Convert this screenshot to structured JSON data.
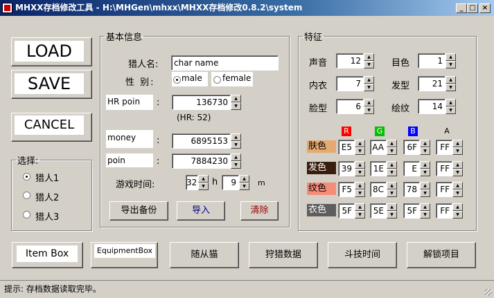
{
  "window": {
    "title": "MHXX存档修改工具 - H:\\MHGen\\mhxx\\MHXX存档修改0.8.2\\system",
    "min": "_",
    "max": "□",
    "close": "×"
  },
  "actions": {
    "load": "LOAD",
    "save": "SAVE",
    "cancel": "CANCEL"
  },
  "select_group": {
    "title": "选择:",
    "options": [
      "猎人1",
      "猎人2",
      "猎人3"
    ],
    "selected": 0
  },
  "basic": {
    "title": "基本信息",
    "name_label": "猎人名:",
    "name": "char name",
    "gender_label": "性 别:",
    "male": "male",
    "female": "female",
    "hr_label": "HR poin",
    "hr_value": "136730",
    "hr_note": "(HR: 52)",
    "money_label": "money",
    "money_value": "6895153",
    "point_label": "poin",
    "point_value": "7884230",
    "playtime_label": "游戏时间:",
    "hours": "32",
    "h": "h",
    "minutes": "9",
    "m": "m",
    "colon": ":",
    "export_btn": "导出备份",
    "import_btn": "导入",
    "clear_btn": "清除",
    "clear_color": "#a00000",
    "import_color": "#000080"
  },
  "features": {
    "title": "特征",
    "voice_label": "声音",
    "voice": "12",
    "eye_label": "目色",
    "eye": "1",
    "inner_label": "内衣",
    "inner": "7",
    "hair_label": "发型",
    "hair": "21",
    "face_label": "脸型",
    "face": "6",
    "paint_label": "绘纹",
    "paint": "14",
    "rgba_headers": [
      "R",
      "G",
      "B",
      "A"
    ],
    "rgba_colors": [
      "#ff0000",
      "#00c000",
      "#0000ff",
      "#d4d0c8"
    ],
    "color_rows": [
      {
        "label": "肤色",
        "swatch": "#e5aa6f",
        "fg": "#000000",
        "values": [
          "E5",
          "AA",
          "6F",
          "FF"
        ]
      },
      {
        "label": "发色",
        "swatch": "#391e0e",
        "fg": "#ffffff",
        "values": [
          "39",
          "1E",
          "E",
          "FF"
        ]
      },
      {
        "label": "纹色",
        "swatch": "#f58c78",
        "fg": "#000000",
        "values": [
          "F5",
          "8C",
          "78",
          "FF"
        ]
      },
      {
        "label": "衣色",
        "swatch": "#5f5e5f",
        "fg": "#ffffff",
        "values": [
          "5F",
          "5E",
          "5F",
          "FF"
        ]
      }
    ]
  },
  "bottom": {
    "item_box": "Item Box",
    "equipment_box": "EquipmentBox",
    "felyne": "随从猫",
    "hunting": "狩猎数据",
    "arena": "斗技时间",
    "unlock": "解锁项目"
  },
  "status": "提示: 存档数据读取完毕。"
}
